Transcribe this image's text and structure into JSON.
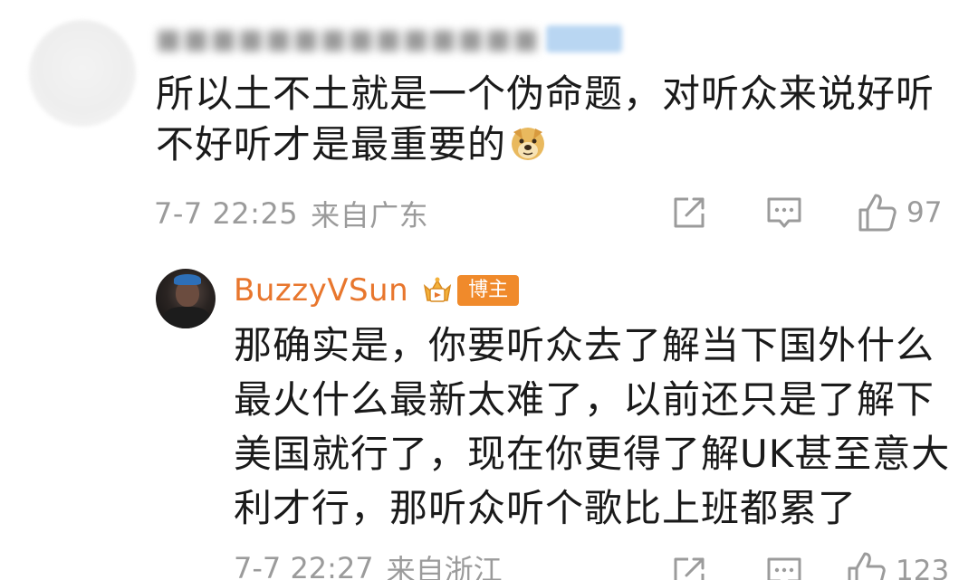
{
  "comment": {
    "text": "所以土不土就是一个伪命题，对听众来说好听不好听才是最重要的",
    "emoji_icon": "doge-emoji",
    "time": "7-7 22:25",
    "location": "来自广东",
    "like_count": "97"
  },
  "reply": {
    "author": "BuzzyVSun",
    "badge": "博主",
    "text": "那确实是，你要听众去了解当下国外什么最火什么最新太难了，以前还只是了解下美国就行了，现在你更得了解UK甚至意大利才行，那听众听个歌比上班都累了",
    "time": "7-7 22:27",
    "location": "来自浙江",
    "like_count": "123"
  },
  "colors": {
    "author_orange": "#e8762d",
    "badge_orange": "#f08a2b",
    "meta_gray": "#9b9b9b",
    "text_dark": "#1a1a1a"
  }
}
